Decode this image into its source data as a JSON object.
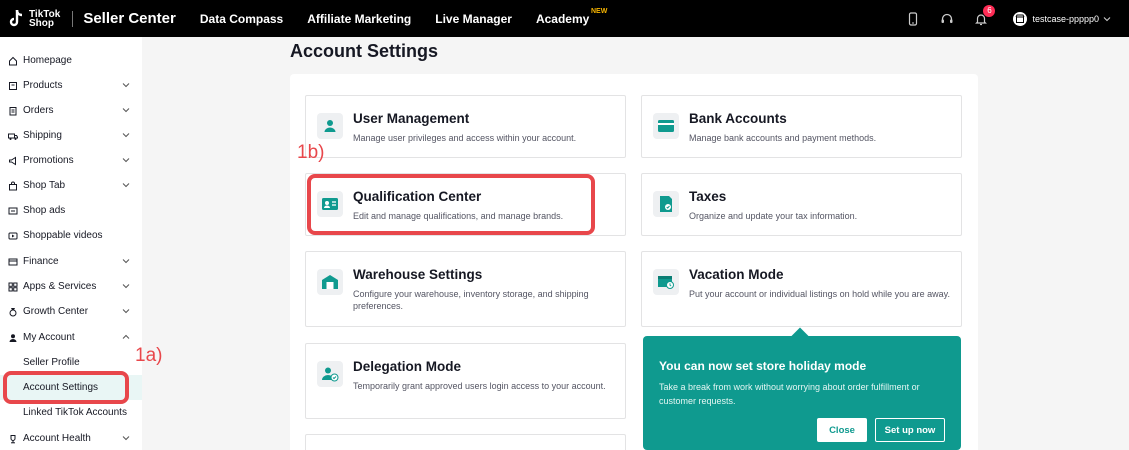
{
  "topbar": {
    "logo_line1": "TikTok",
    "logo_line2": "Shop",
    "brand": "Seller Center",
    "nav": [
      "Data Compass",
      "Affiliate Marketing",
      "Live Manager",
      "Academy"
    ],
    "new_badge": "NEW",
    "notification_count": "6",
    "username": "testcase-ppppp0"
  },
  "sidebar": {
    "items": [
      {
        "label": "Homepage",
        "icon": "home-icon"
      },
      {
        "label": "Products",
        "icon": "box-icon"
      },
      {
        "label": "Orders",
        "icon": "clipboard-icon"
      },
      {
        "label": "Shipping",
        "icon": "truck-icon"
      },
      {
        "label": "Promotions",
        "icon": "megaphone-icon"
      },
      {
        "label": "Shop Tab",
        "icon": "bag-icon"
      },
      {
        "label": "Shop ads",
        "icon": "ads-icon"
      },
      {
        "label": "Shoppable videos",
        "icon": "video-icon"
      },
      {
        "label": "Finance",
        "icon": "wallet-icon"
      },
      {
        "label": "Apps & Services",
        "icon": "apps-icon"
      },
      {
        "label": "Growth Center",
        "icon": "medal-icon"
      },
      {
        "label": "My Account",
        "icon": "person-icon"
      },
      {
        "label": "Account Health",
        "icon": "trophy-icon"
      }
    ],
    "sub_items": [
      "Seller Profile",
      "Account Settings",
      "Linked TikTok Accounts"
    ]
  },
  "main": {
    "title": "Account Settings",
    "cards": [
      {
        "title": "User Management",
        "desc": "Manage user privileges and access within your account."
      },
      {
        "title": "Bank Accounts",
        "desc": "Manage bank accounts and payment methods."
      },
      {
        "title": "Qualification Center",
        "desc": "Edit and manage qualifications, and manage brands."
      },
      {
        "title": "Taxes",
        "desc": "Organize and update your tax information."
      },
      {
        "title": "Warehouse Settings",
        "desc": "Configure your warehouse, inventory storage, and shipping preferences."
      },
      {
        "title": "Vacation Mode",
        "desc": "Put your account or individual listings on hold while you are away."
      },
      {
        "title": "Delegation Mode",
        "desc": "Temporarily grant approved users login access to your account."
      }
    ]
  },
  "annotations": {
    "a": "1a)",
    "b": "1b)"
  },
  "tooltip": {
    "title": "You can now set store holiday mode",
    "desc": "Take a break from work without worrying about order fulfillment or customer requests.",
    "close": "Close",
    "setup": "Set up now"
  },
  "colors": {
    "accent": "#0f9a8f",
    "annotation": "#e8474b",
    "topbar": "#000000"
  }
}
